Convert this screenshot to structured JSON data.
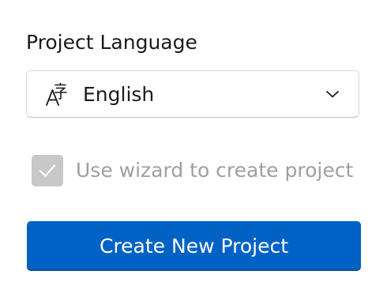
{
  "project_language": {
    "label": "Project Language",
    "selected_value": "English",
    "icon": "language-icon",
    "dropdown_icon": "chevron-down-icon"
  },
  "wizard_option": {
    "label": "Use wizard to create project",
    "checked": true,
    "disabled": true,
    "icon": "checkmark-icon"
  },
  "actions": {
    "create_label": "Create New Project"
  },
  "colors": {
    "accent": "#0062c4",
    "disabled_text": "#9f9f9f",
    "disabled_checkbox": "#c8c8c8"
  }
}
